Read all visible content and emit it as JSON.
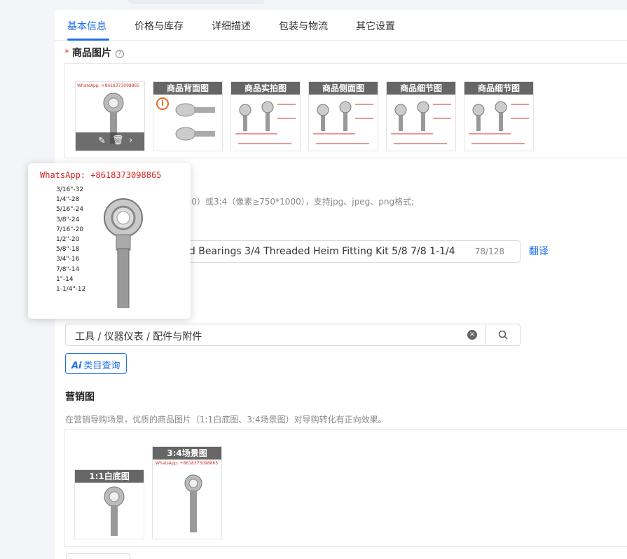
{
  "tabs": [
    {
      "label": "基本信息",
      "active": true
    },
    {
      "label": "价格与库存",
      "active": false
    },
    {
      "label": "详细描述",
      "active": false
    },
    {
      "label": "包装与物流",
      "active": false
    },
    {
      "label": "其它设置",
      "active": false
    }
  ],
  "images_section": {
    "required_mark": "*",
    "title": "商品图片",
    "thumb_captions": [
      "商品背面图",
      "商品实拍图",
      "商品侧面图",
      "商品细节图",
      "商品细节图"
    ],
    "first_thumb_text": "WhatsApp: +8618373098865",
    "hint_partial": "800）或3:4（像素≥750*1000），支持jpg、jpeg、png格式;"
  },
  "popover": {
    "whatsapp": "WhatsApp: +8618373098865",
    "sizes": [
      "3/16\"-32",
      "1/4\"-28",
      "5/16\"-24",
      "3/8\"-24",
      "7/16\"-20",
      "1/2\"-20",
      "5/8\"-18",
      "3/4\"-16",
      "7/8\"-14",
      "1\"-14",
      "1-1/4\"-12"
    ]
  },
  "title_field": {
    "value": "nd Bearings 3/4 Threaded Heim Fitting Kit 5/8 7/8 1-1/4",
    "counter": "78/128",
    "translate_label": "翻译"
  },
  "category_field": {
    "value": "工具 / 仪器仪表 / 配件与附件",
    "ai_label": "类目查询",
    "ai_prefix": "Ai"
  },
  "marketing": {
    "title": "营销图",
    "hint": "在营销导购场景，优质的商品图片（1:1白底图、3:4场景图）对导购转化有正向效果。",
    "captions": [
      "1:1白底图",
      "3:4场景图"
    ],
    "thumb_text": "WhatsApp: +8618373098865"
  },
  "colors": {
    "accent": "#1f6feb",
    "required": "#e5484d",
    "warning": "#e86a1c"
  }
}
